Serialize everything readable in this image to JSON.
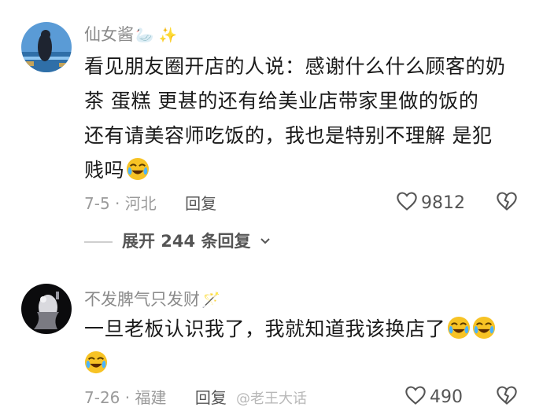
{
  "comments": [
    {
      "username": "仙女酱",
      "username_decorations": "🦢 ✨",
      "text_lines": [
        "看见朋友圈开店的人说：感谢什么什么顾客的奶",
        "茶  蛋糕  更甚的还有给美业店带家里做的饭的",
        "还有请美容师吃饭的，我也是特别不理解  是犯",
        "贱吗"
      ],
      "date_location": "7-5 · 河北",
      "reply_label": "回复",
      "likes": "9812",
      "expand_label": "展开 244 条回复"
    },
    {
      "username": "不发脾气只发财",
      "username_decorations": "🪄",
      "text_lines": [
        "一旦老板认识我了，我就知道我该换店了"
      ],
      "date_location": "7-26 · 福建",
      "reply_label": "回复",
      "likes": "490"
    }
  ],
  "watermark": "@老王大话",
  "icons": {
    "like": "heart-outline-icon",
    "dislike": "broken-heart-icon",
    "expand": "chevron-down-icon",
    "emoji": "laughing-crying-emoji"
  },
  "colors": {
    "username": "#8a8a8a",
    "meta": "#9b9b9b",
    "text": "#1a1a1a",
    "emoji_face": "#f7c325"
  }
}
